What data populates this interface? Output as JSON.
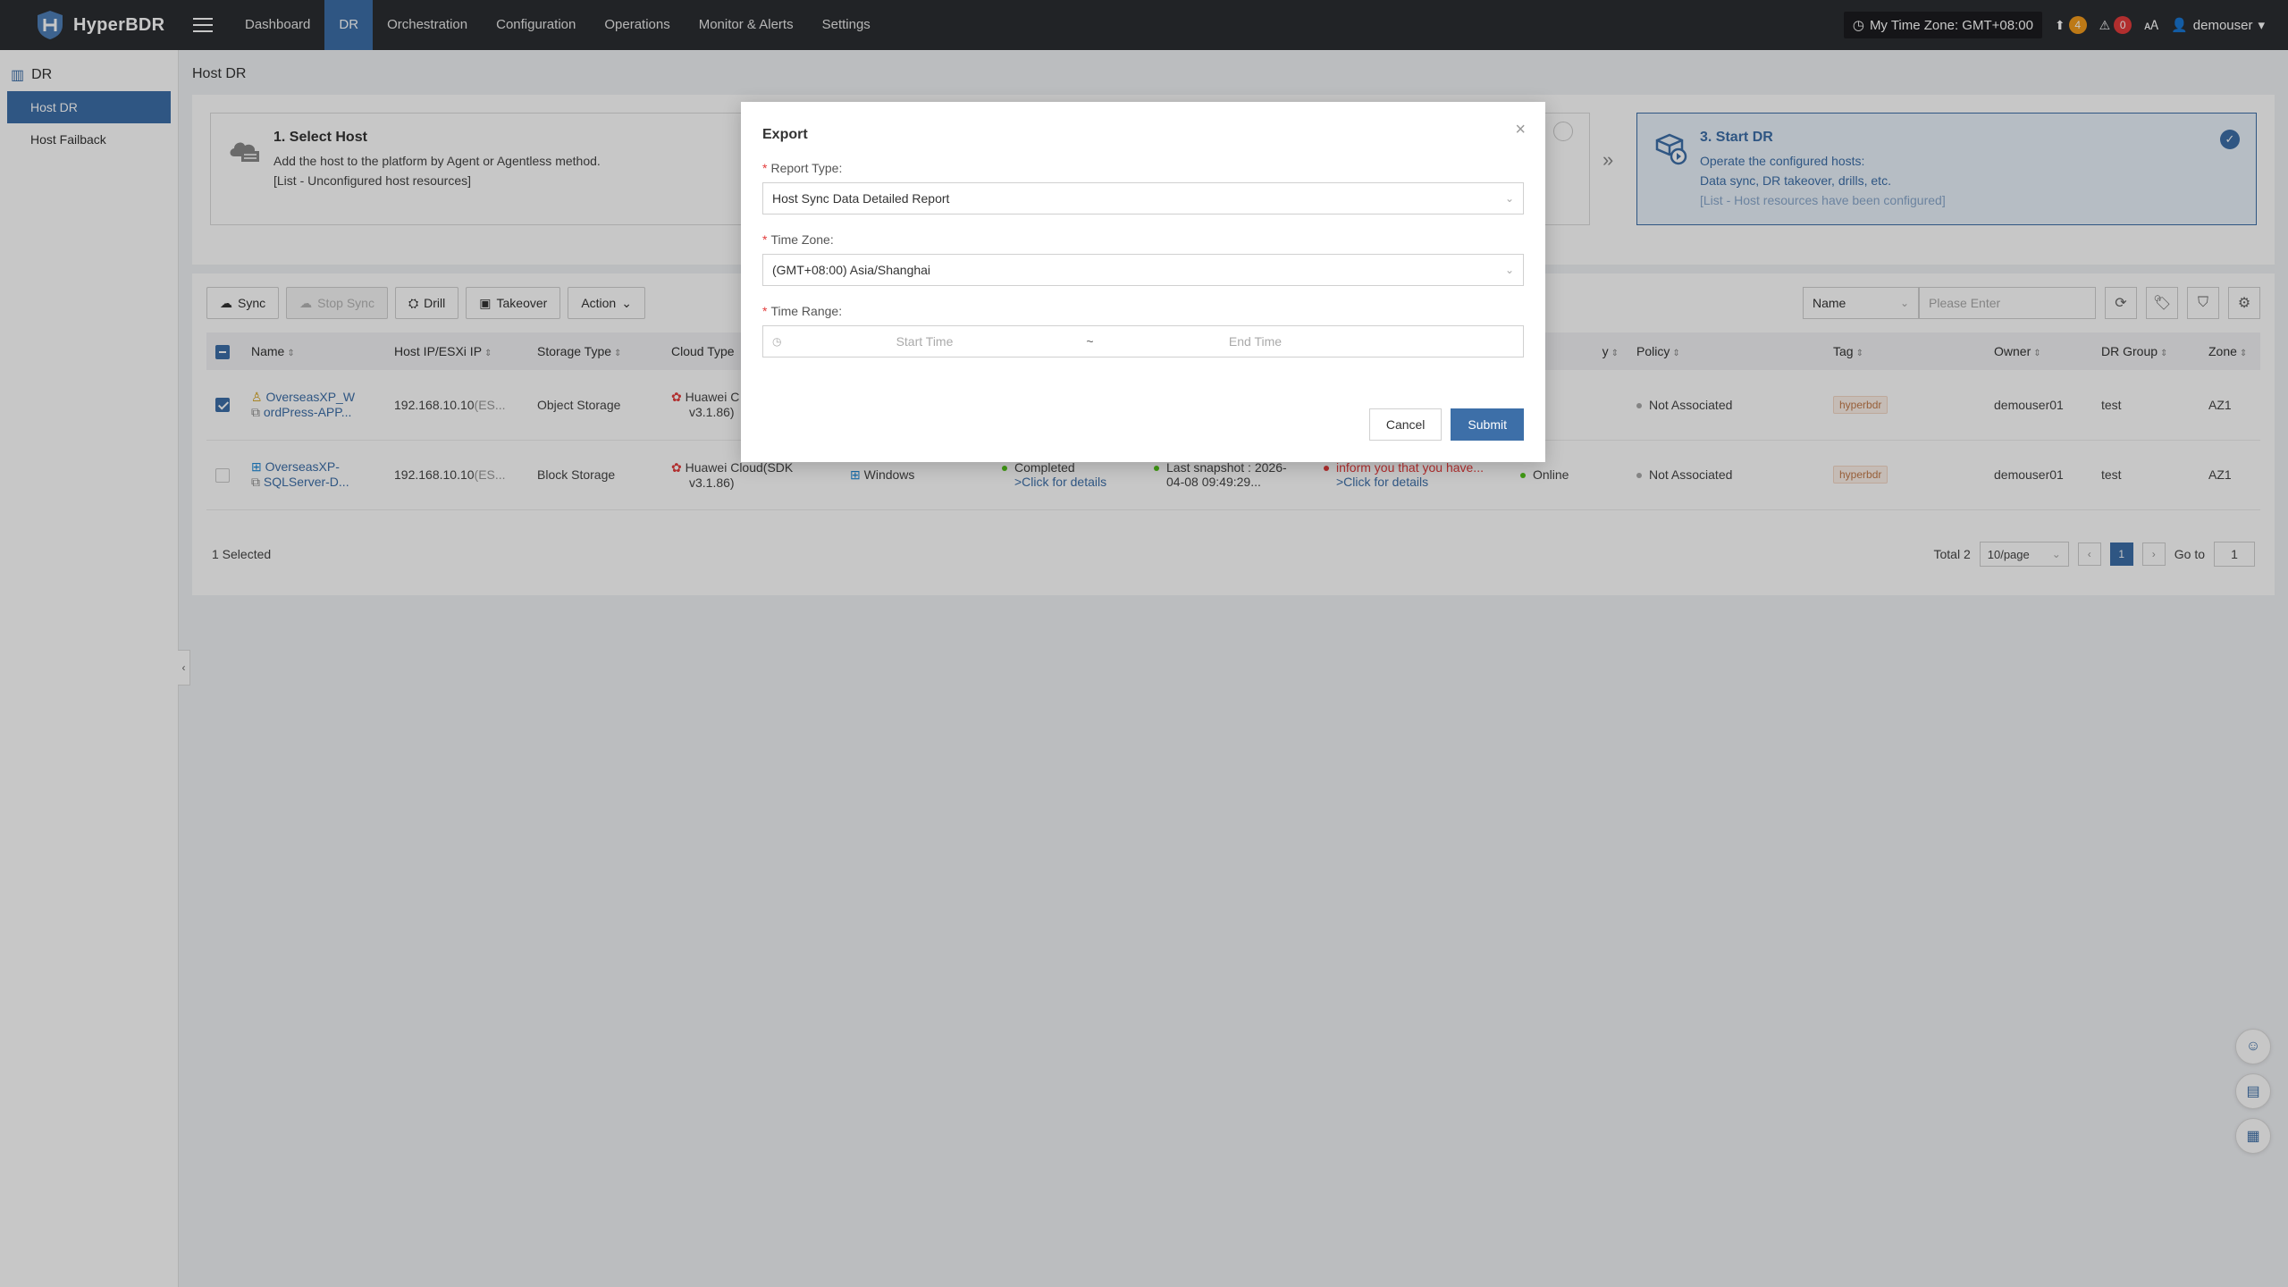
{
  "app": {
    "name": "HyperBDR"
  },
  "nav": {
    "items": [
      "Dashboard",
      "DR",
      "Orchestration",
      "Configuration",
      "Operations",
      "Monitor & Alerts",
      "Settings"
    ],
    "active": "DR"
  },
  "topbar": {
    "timezone": "My Time Zone: GMT+08:00",
    "upload_count": "4",
    "alert_count": "0",
    "username": "demouser"
  },
  "sidebar": {
    "section": "DR",
    "items": [
      "Host DR",
      "Host Failback"
    ]
  },
  "page": {
    "title": "Host DR"
  },
  "steps": {
    "s1": {
      "title": "1. Select Host",
      "line1": "Add the host to the platform by Agent or Agentless method.",
      "line2": "[List - Unconfigured host resources]"
    },
    "s3": {
      "title": "3. Start DR",
      "line1": "Operate the configured hosts:",
      "line2": "Data sync, DR takeover, drills, etc.",
      "line3": "[List - Host resources have been configured]"
    }
  },
  "toolbar": {
    "sync": "Sync",
    "stop_sync": "Stop Sync",
    "drill": "Drill",
    "takeover": "Takeover",
    "action": "Action",
    "filter_field": "Name",
    "search_placeholder": "Please Enter"
  },
  "table": {
    "headers": [
      "Name",
      "Host IP/ESXi IP",
      "Storage Type",
      "Cloud Type",
      "y",
      "Policy",
      "Tag",
      "Owner",
      "DR Group",
      "Zone"
    ],
    "rows": [
      {
        "name_l1": "OverseasXP_W",
        "name_l2": "ordPress-APP...",
        "ip": "192.168.10.10",
        "ip_suffix": "(ES...",
        "storage": "Object Storage",
        "cloud_l1": "Huawei C",
        "cloud_l2": "v3.1.86)",
        "policy": "Not Associated",
        "tag": "hyperbdr",
        "owner": "demouser01",
        "group": "test",
        "zone": "AZ1"
      },
      {
        "name_l1": "OverseasXP-",
        "name_l2": "SQLServer-D...",
        "ip": "192.168.10.10",
        "ip_suffix": "(ES...",
        "storage": "Block Storage",
        "cloud_l1": "Huawei Cloud(SDK",
        "cloud_l2": "v3.1.86)",
        "os": "Windows",
        "sync_status": "Completed",
        "sync_link": ">Click for details",
        "snapshot_l1": "Last snapshot : 2026-",
        "snapshot_l2": "04-08 09:49:29...",
        "message": "inform you that you have...",
        "message_link": ">Click for details",
        "status": "Online",
        "policy": "Not Associated",
        "tag": "hyperbdr",
        "owner": "demouser01",
        "group": "test",
        "zone": "AZ1"
      }
    ]
  },
  "footer": {
    "selected": "1 Selected",
    "total": "Total 2",
    "page_size": "10/page",
    "current_page": "1",
    "goto_label": "Go to",
    "goto_value": "1"
  },
  "modal": {
    "title": "Export",
    "report_type_label": "Report Type:",
    "report_type_value": "Host Sync Data Detailed Report",
    "timezone_label": "Time Zone:",
    "timezone_value": "(GMT+08:00) Asia/Shanghai",
    "time_range_label": "Time Range:",
    "start_placeholder": "Start Time",
    "range_sep": "~",
    "end_placeholder": "End Time",
    "cancel": "Cancel",
    "submit": "Submit"
  },
  "colors": {
    "accent": "#3d6fa8",
    "topbar": "#2b2d31",
    "danger": "#e33b3b",
    "success": "#52c41a"
  }
}
